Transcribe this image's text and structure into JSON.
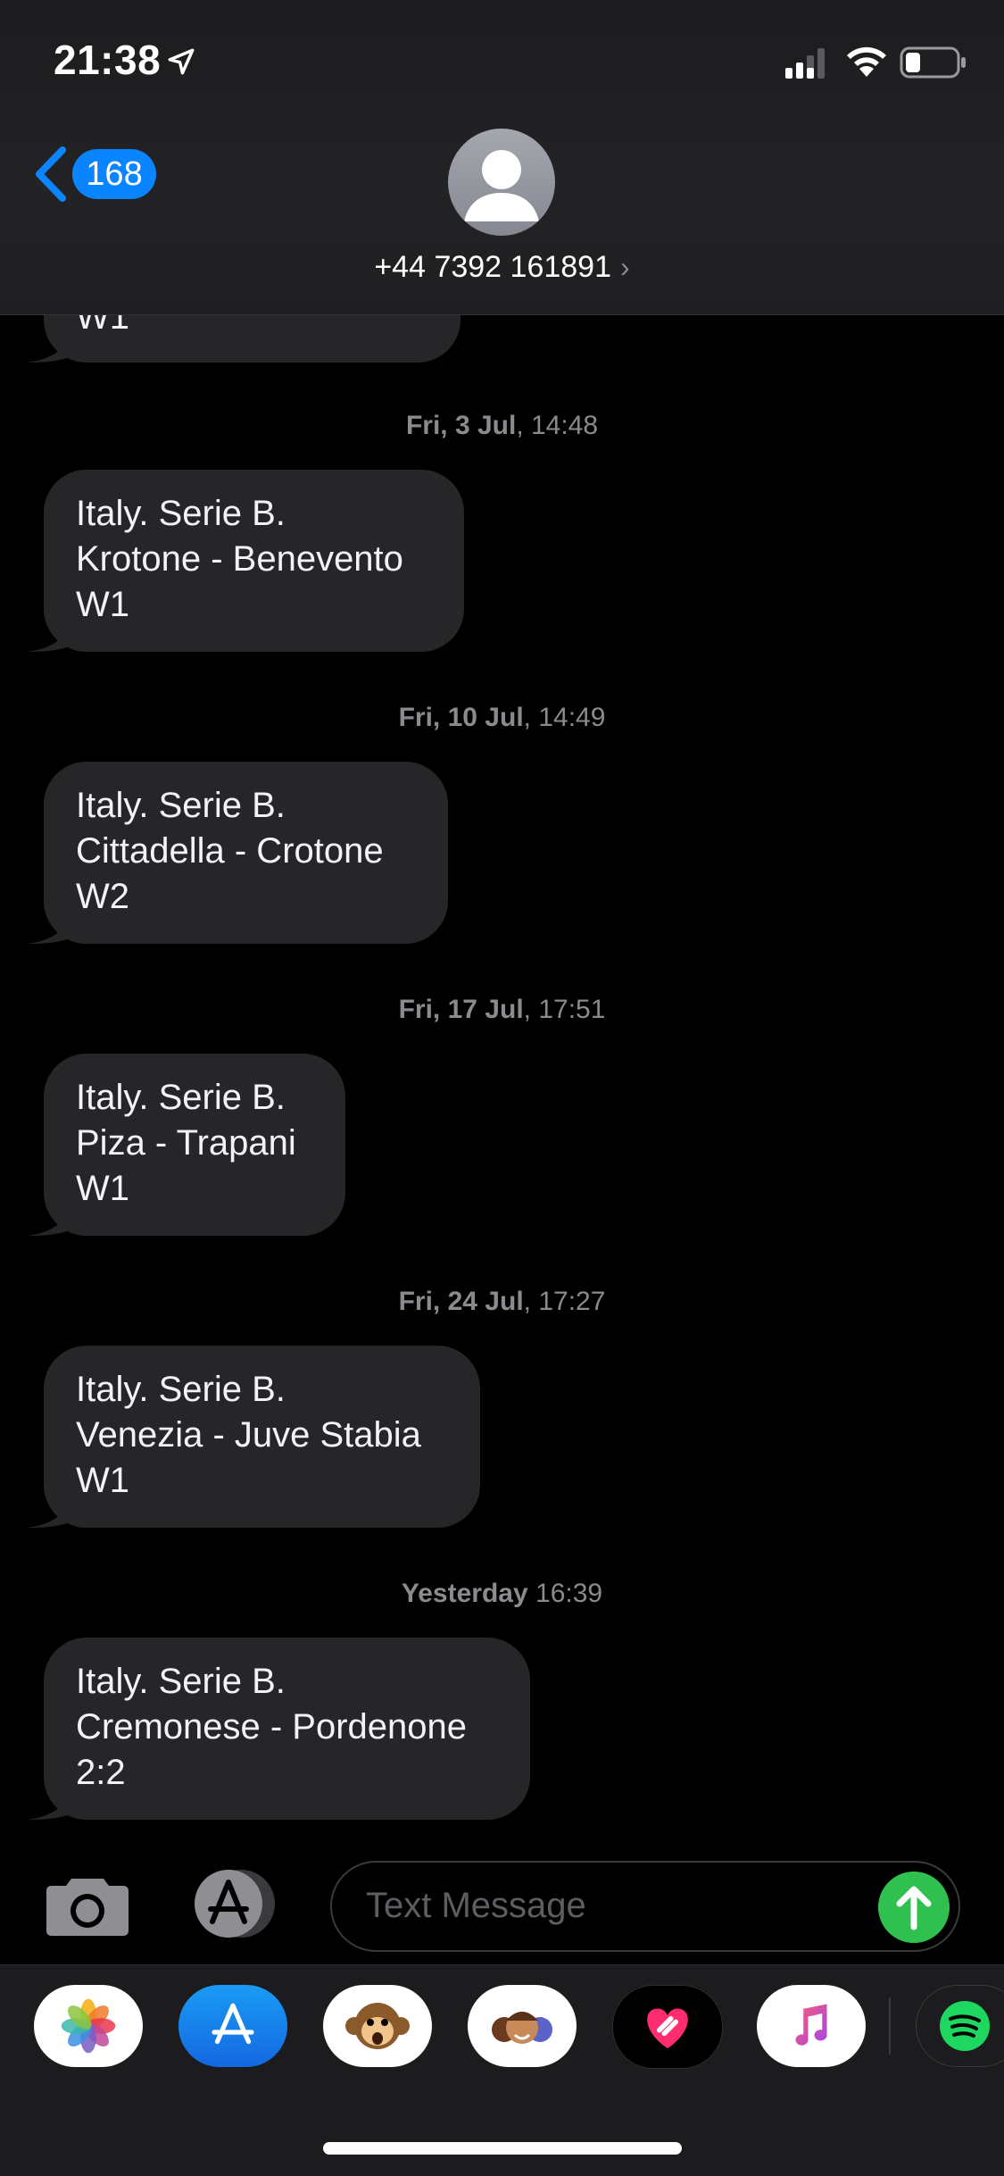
{
  "status_bar": {
    "time": "21:38"
  },
  "header": {
    "back_badge": "168",
    "contact": "+44 7392 161891",
    "contact_chevron": "›"
  },
  "messages": [
    {
      "type": "partial_bubble",
      "lines": [
        "W1"
      ]
    },
    {
      "type": "timestamp",
      "day": "Fri, 3 Jul",
      "time": ", 14:48"
    },
    {
      "type": "bubble",
      "lines": [
        "Italy. Serie B.",
        "Krotone - Benevento",
        "W1"
      ]
    },
    {
      "type": "timestamp",
      "day": "Fri, 10 Jul",
      "time": ", 14:49"
    },
    {
      "type": "bubble",
      "lines": [
        "Italy. Serie B.",
        "Cittadella - Crotone",
        "W2"
      ]
    },
    {
      "type": "timestamp",
      "day": "Fri, 17 Jul",
      "time": ", 17:51"
    },
    {
      "type": "bubble",
      "lines": [
        "Italy. Serie B.",
        "Piza - Trapani",
        "W1"
      ]
    },
    {
      "type": "timestamp",
      "day": "Fri, 24 Jul",
      "time": ", 17:27"
    },
    {
      "type": "bubble",
      "lines": [
        "Italy. Serie B.",
        "Venezia - Juve Stabia",
        "W1"
      ]
    },
    {
      "type": "timestamp",
      "day": "Yesterday",
      "time": " 16:39"
    },
    {
      "type": "bubble",
      "lines": [
        "Italy. Serie B.",
        "Cremonese - Pordenone",
        "2:2"
      ]
    }
  ],
  "compose": {
    "placeholder": "Text Message"
  },
  "app_drawer": {
    "apps": [
      "photos-app-icon",
      "app-store-icon",
      "animoji-monkey-icon",
      "memoji-icon",
      "heart-sticker-icon",
      "music-icon",
      "spotify-icon"
    ]
  },
  "colors": {
    "accent": "#0a84ff",
    "bubble": "#262628",
    "send": "#30c04f",
    "timestamp": "#8a8a8f"
  }
}
